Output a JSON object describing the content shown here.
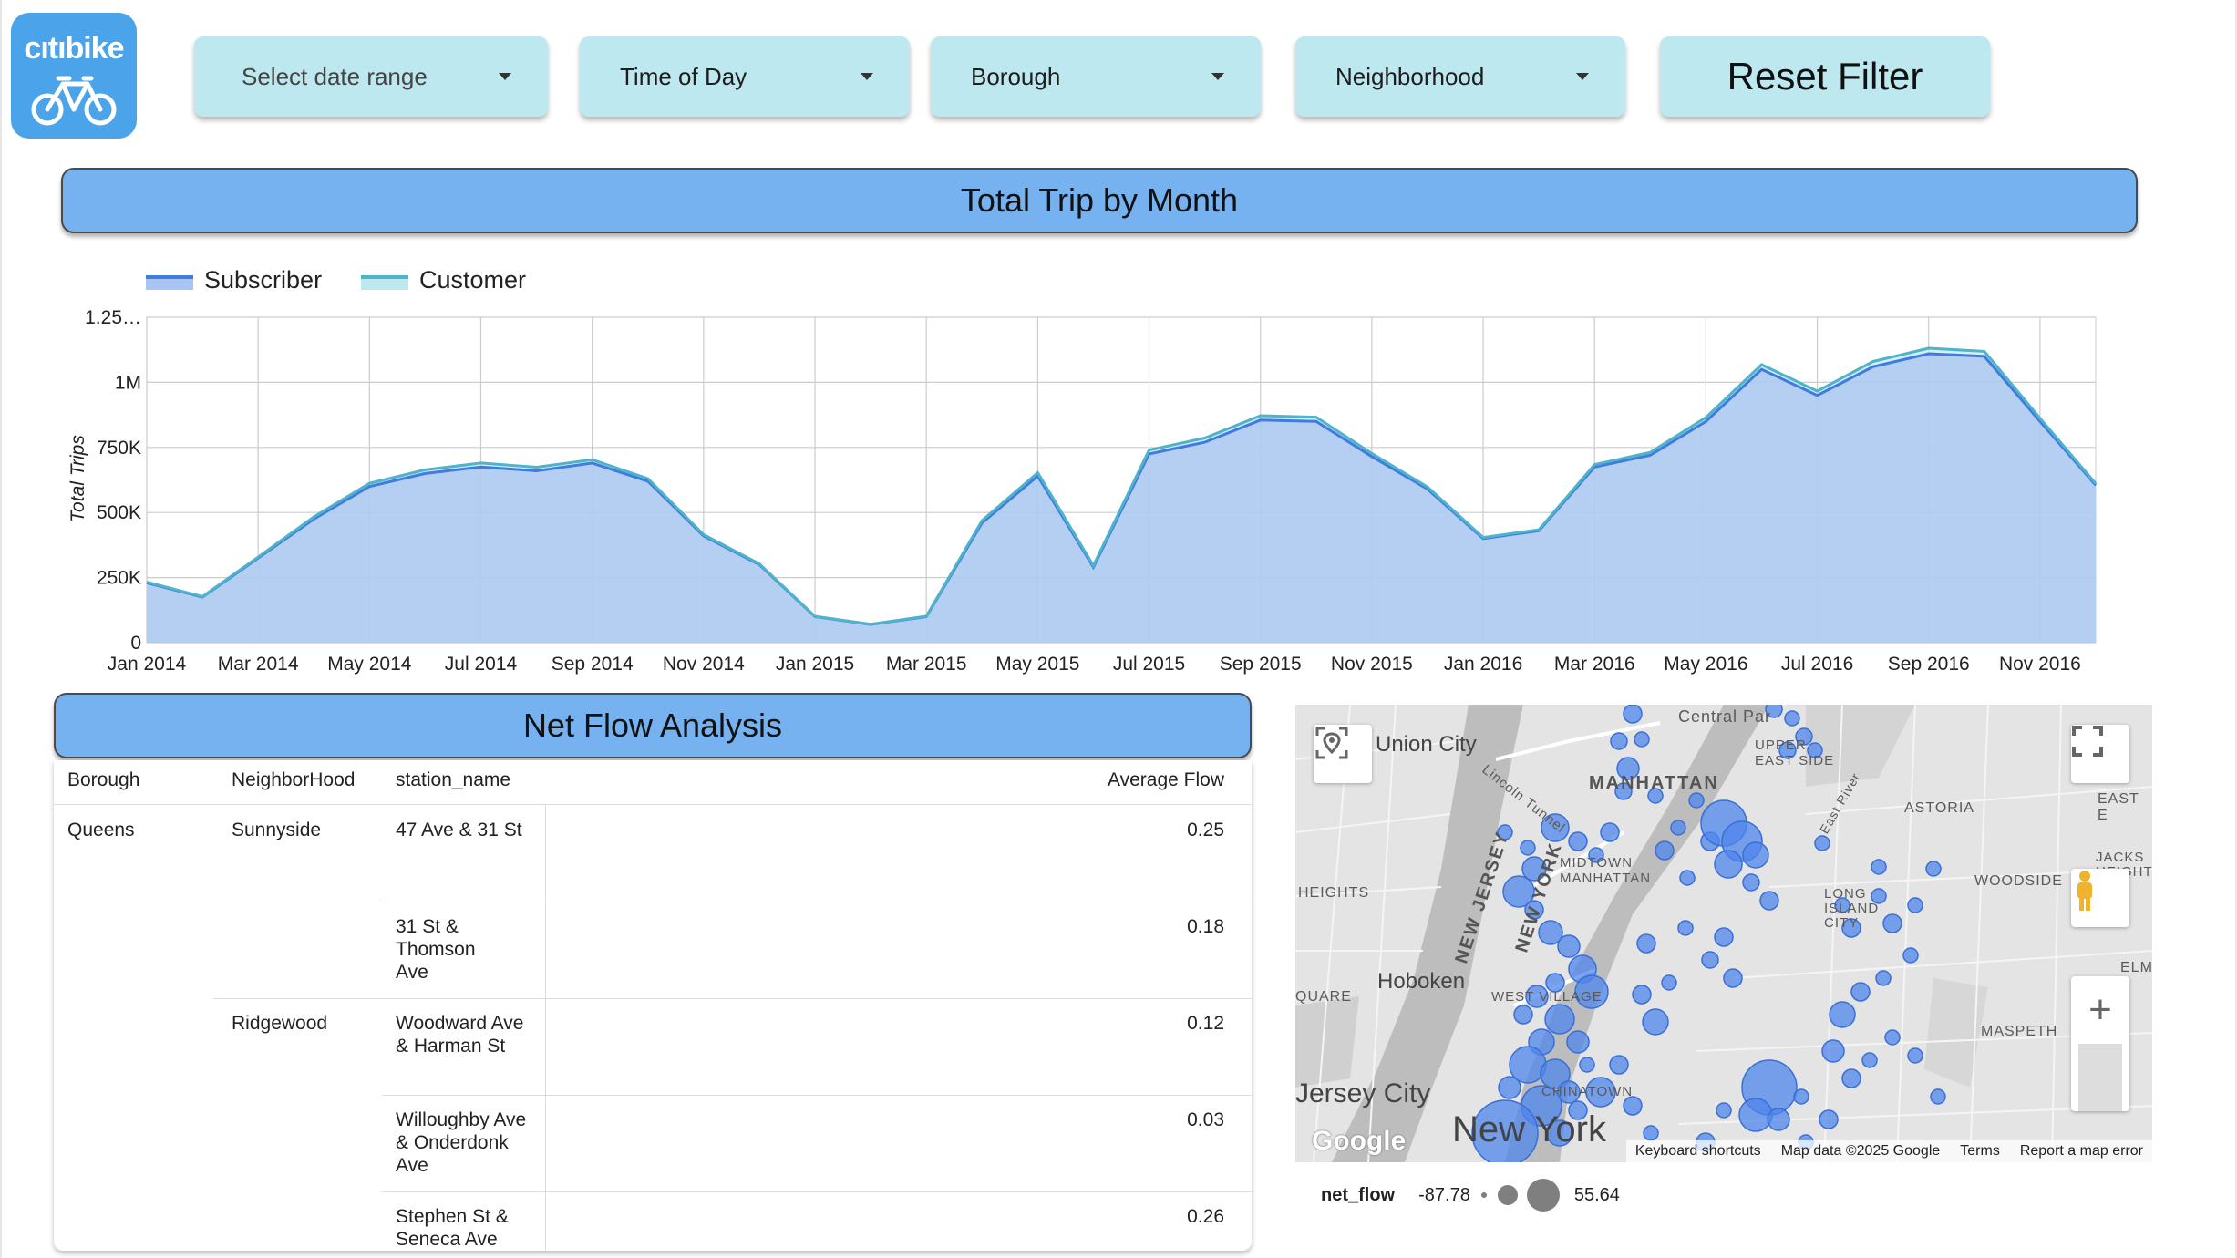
{
  "logo": {
    "brand": "citibike",
    "text_pre": "cıtı",
    "text_post": "bike"
  },
  "filters": {
    "date_range": "Select date range",
    "time_of_day": "Time of Day",
    "borough": "Borough",
    "neighborhood": "Neighborhood",
    "reset": "Reset Filter"
  },
  "trip_section": {
    "title": "Total Trip by Month"
  },
  "chart_data": {
    "type": "area",
    "title": "Total Trip by Month",
    "ylabel": "Total Trips",
    "xlabel": "",
    "ylim": [
      0,
      1250000
    ],
    "y_ticks": [
      {
        "v": 0,
        "label": "0"
      },
      {
        "v": 250000,
        "label": "250K"
      },
      {
        "v": 500000,
        "label": "500K"
      },
      {
        "v": 750000,
        "label": "750K"
      },
      {
        "v": 1000000,
        "label": "1M"
      },
      {
        "v": 1250000,
        "label": "1.25…"
      }
    ],
    "x": [
      "Jan 2014",
      "Feb 2014",
      "Mar 2014",
      "Apr 2014",
      "May 2014",
      "Jun 2014",
      "Jul 2014",
      "Aug 2014",
      "Sep 2014",
      "Oct 2014",
      "Nov 2014",
      "Dec 2014",
      "Jan 2015",
      "Feb 2015",
      "Mar 2015",
      "Apr 2015",
      "May 2015",
      "Jun 2015",
      "Jul 2015",
      "Aug 2015",
      "Sep 2015",
      "Oct 2015",
      "Nov 2015",
      "Dec 2015",
      "Jan 2016",
      "Feb 2016",
      "Mar 2016",
      "Apr 2016",
      "May 2016",
      "Jun 2016",
      "Jul 2016",
      "Aug 2016",
      "Sep 2016",
      "Oct 2016",
      "Nov 2016",
      "Dec 2016"
    ],
    "x_tick_labels": [
      "Jan 2014",
      "Mar 2014",
      "May 2014",
      "Jul 2014",
      "Sep 2014",
      "Nov 2014",
      "Jan 2015",
      "Mar 2015",
      "May 2015",
      "Jul 2015",
      "Sep 2015",
      "Nov 2015",
      "Jan 2016",
      "Mar 2016",
      "May 2016",
      "Jul 2016",
      "Sep 2016",
      "Nov 2016"
    ],
    "legend": "top-left",
    "grid": true,
    "series": [
      {
        "name": "Subscriber",
        "color": "#3f7be0",
        "values": [
          230000,
          175000,
          325000,
          475000,
          600000,
          650000,
          675000,
          660000,
          690000,
          620000,
          410000,
          300000,
          100000,
          70000,
          100000,
          460000,
          640000,
          290000,
          725000,
          770000,
          855000,
          850000,
          715000,
          590000,
          400000,
          430000,
          675000,
          720000,
          850000,
          1050000,
          950000,
          1060000,
          1110000,
          1100000,
          850000,
          605000
        ]
      },
      {
        "name": "Customer",
        "color": "#4fb3c9",
        "values": [
          3000,
          2000,
          4000,
          8000,
          12000,
          14000,
          15000,
          14000,
          13000,
          10000,
          5000,
          3000,
          1000,
          800,
          1500,
          9000,
          13000,
          6000,
          15000,
          16000,
          17000,
          16000,
          12000,
          8000,
          4000,
          4000,
          9000,
          11000,
          15000,
          18000,
          16000,
          20000,
          21000,
          19000,
          12000,
          6000
        ]
      }
    ]
  },
  "net_flow": {
    "title": "Net Flow Analysis",
    "columns": [
      "Borough",
      "NeighborHood",
      "station_name",
      "Average Flow"
    ],
    "borough": "Queens",
    "groups": [
      {
        "neighborhood": "Sunnyside",
        "stations": [
          {
            "name": "47 Ave & 31 St",
            "flow": "0.25"
          },
          {
            "name": "31 St & Thomson Ave",
            "flow": "0.18"
          }
        ]
      },
      {
        "neighborhood": "Ridgewood",
        "stations": [
          {
            "name": "Woodward Ave & Harman St",
            "flow": "0.12"
          },
          {
            "name": "Willoughby Ave & Onderdonk Ave",
            "flow": "0.03"
          },
          {
            "name": "Stephen St & Seneca Ave",
            "flow": "0.26"
          }
        ]
      }
    ]
  },
  "map": {
    "labels": {
      "union_city": "Union City",
      "manhattan": "MANHATTAN",
      "upper_east_side": "UPPER EAST SIDE",
      "astoria": "ASTORIA",
      "east": "EAST E",
      "jackson": "JACKS HEIGHT",
      "woodside": "WOODSIDE",
      "heights": "HEIGHTS",
      "midtown": "MIDTOWN MANHATTAN",
      "lincoln": "Lincoln Tunnel",
      "new_jersey": "NEW JERSEY",
      "new_york_state": "NEW YORK",
      "long_island_city": "LONG ISLAND CITY",
      "hoboken": "Hoboken",
      "square": "QUARE",
      "west_village": "WEST VILLAGE",
      "elmh": "ELMH",
      "maspeth": "MASPETH",
      "jersey_city": "Jersey City",
      "new_york": "New York",
      "central_park": "Central Par",
      "east_river": "East River",
      "chinatown": "CHINATOWN"
    },
    "attribution": [
      "Keyboard shortcuts",
      "Map data ©2025 Google",
      "Terms",
      "Report a map error"
    ],
    "google": "Google",
    "marker_color": "#4f86ec"
  },
  "map_legend": {
    "title": "net_flow",
    "min": "-87.78",
    "max": "55.64"
  }
}
